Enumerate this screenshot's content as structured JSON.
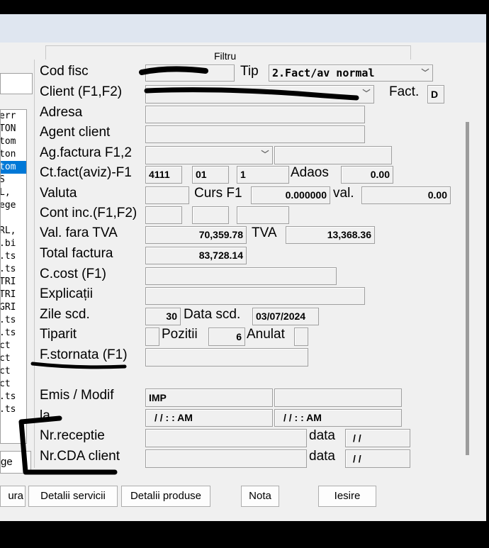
{
  "filter": {
    "label": "Filtru"
  },
  "sidebar": {
    "lines": [
      "err",
      "TON",
      "tom",
      "ton",
      "tom",
      "S",
      "L,",
      "ege",
      "",
      "RL,",
      ".bi",
      ".ts",
      ".ts",
      "TRI",
      "TRI",
      "GRI",
      ".ts",
      ".ts",
      "ct",
      "ct",
      "ct",
      "ct",
      ".ts",
      ".ts"
    ],
    "bottom_label": "ge"
  },
  "form": {
    "cod_fisc": {
      "label": "Cod fisc"
    },
    "tip": {
      "label": "Tip",
      "value": "2.Fact/av normal"
    },
    "client": {
      "label": "Client (F1,F2)"
    },
    "fact": {
      "label": "Fact.",
      "value": "D"
    },
    "adresa": {
      "label": "Adresa",
      "value": ""
    },
    "agent_client": {
      "label": "Agent client",
      "value": ""
    },
    "ag_factura": {
      "label": "Ag.factura F1,2",
      "value": ""
    },
    "ct_fact": {
      "label": "Ct.fact(aviz)-F1",
      "v1": "4111",
      "v2": "01",
      "v3": "1"
    },
    "adaos": {
      "label": "Adaos",
      "value": "0.00"
    },
    "valuta": {
      "label": "Valuta",
      "value": ""
    },
    "curs": {
      "label": "Curs F1",
      "value": "0.000000"
    },
    "val": {
      "label": "val.",
      "value": "0.00"
    },
    "cont_inc": {
      "label": "Cont inc.(F1,F2)"
    },
    "val_fara_tva": {
      "label": "Val. fara TVA",
      "value": "70,359.78"
    },
    "tva": {
      "label": "TVA",
      "value": "13,368.36"
    },
    "total_factura": {
      "label": "Total factura",
      "value": "83,728.14"
    },
    "c_cost": {
      "label": "C.cost (F1)",
      "value": ""
    },
    "explicatii": {
      "label": "Explicații",
      "value": ""
    },
    "zile_scd": {
      "label": "Zile scd.",
      "value": "30"
    },
    "data_scd": {
      "label": "Data scd.",
      "value": "03/07/2024"
    },
    "tiparit": {
      "label": "Tiparit"
    },
    "pozitii": {
      "label": "Pozitii",
      "value": "6"
    },
    "anulat": {
      "label": "Anulat"
    },
    "f_stornata": {
      "label": "F.stornata (F1)",
      "value": ""
    },
    "emis_modif": {
      "label": "Emis / Modif",
      "value": "IMP",
      "value2": ""
    },
    "la": {
      "label": "la",
      "value": "/ /   : : AM",
      "value2": "/ /   : : AM"
    },
    "nr_receptie": {
      "label": "Nr.receptie",
      "data_label": "data",
      "data_value": "/ /"
    },
    "nr_cda_client": {
      "label": "Nr.CDA client",
      "data_label": "data",
      "data_value": "/ /"
    }
  },
  "buttons": {
    "factura": "ura",
    "detalii_servicii": "Detalii servicii",
    "detalii_produse": "Detalii produse",
    "nota": "Nota",
    "iesire": "Iesire"
  }
}
